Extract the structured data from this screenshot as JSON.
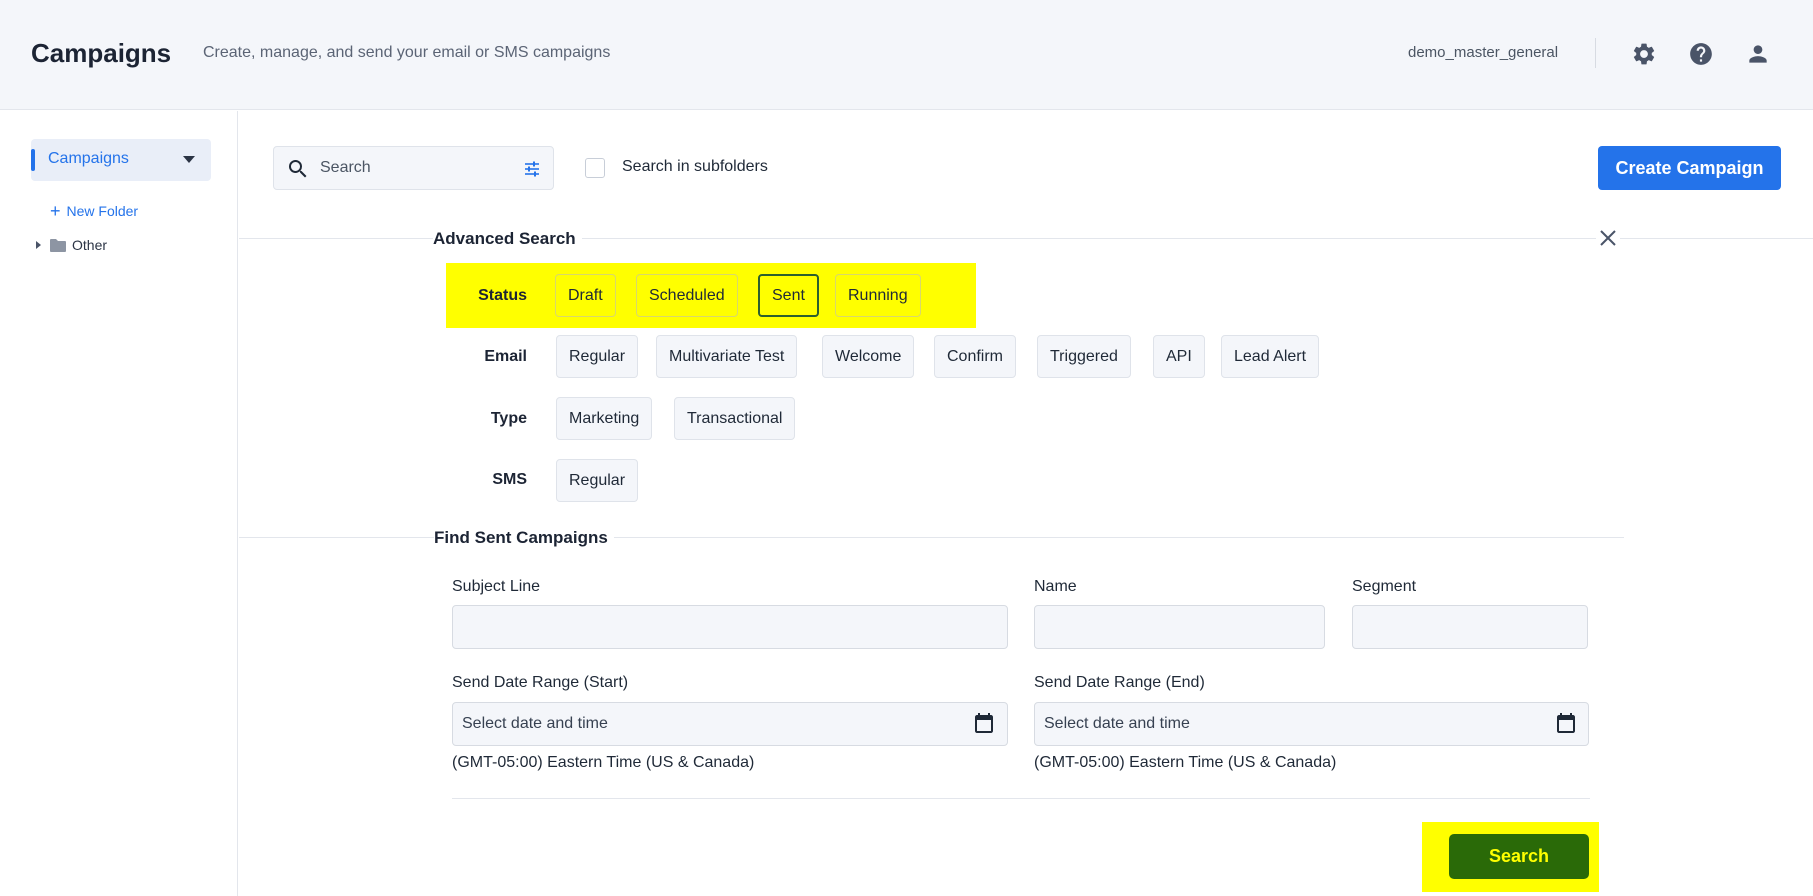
{
  "header": {
    "title": "Campaigns",
    "subtitle": "Create, manage, and send your email or SMS campaigns",
    "account_name": "demo_master_general",
    "icons": [
      "gear-icon",
      "help-icon",
      "user-icon"
    ]
  },
  "sidebar": {
    "active_item": "Campaigns",
    "new_folder_label": "New Folder",
    "folders": [
      {
        "label": "Other"
      }
    ]
  },
  "toolbar": {
    "search_placeholder": "Search",
    "subfolders_label": "Search in subfolders",
    "create_label": "Create Campaign"
  },
  "advanced_search": {
    "title": "Advanced Search",
    "status": {
      "label": "Status",
      "chips": [
        "Draft",
        "Scheduled",
        "Sent",
        "Running"
      ],
      "selected": "Sent"
    },
    "email": {
      "label": "Email",
      "chips": [
        "Regular",
        "Multivariate Test",
        "Welcome",
        "Confirm",
        "Triggered",
        "API",
        "Lead Alert"
      ]
    },
    "type": {
      "label": "Type",
      "chips": [
        "Marketing",
        "Transactional"
      ]
    },
    "sms": {
      "label": "SMS",
      "chips": [
        "Regular"
      ]
    }
  },
  "find_sent": {
    "title": "Find Sent Campaigns",
    "subject_label": "Subject Line",
    "name_label": "Name",
    "segment_label": "Segment",
    "start_label": "Send Date Range (Start)",
    "end_label": "Send Date Range (End)",
    "date_placeholder": "Select date and time",
    "timezone": "(GMT-05:00) Eastern Time (US & Canada)",
    "search_label": "Search"
  },
  "colors": {
    "accent": "#2473ea",
    "highlight": "#ffff00",
    "search_button": "#2a6a08"
  }
}
